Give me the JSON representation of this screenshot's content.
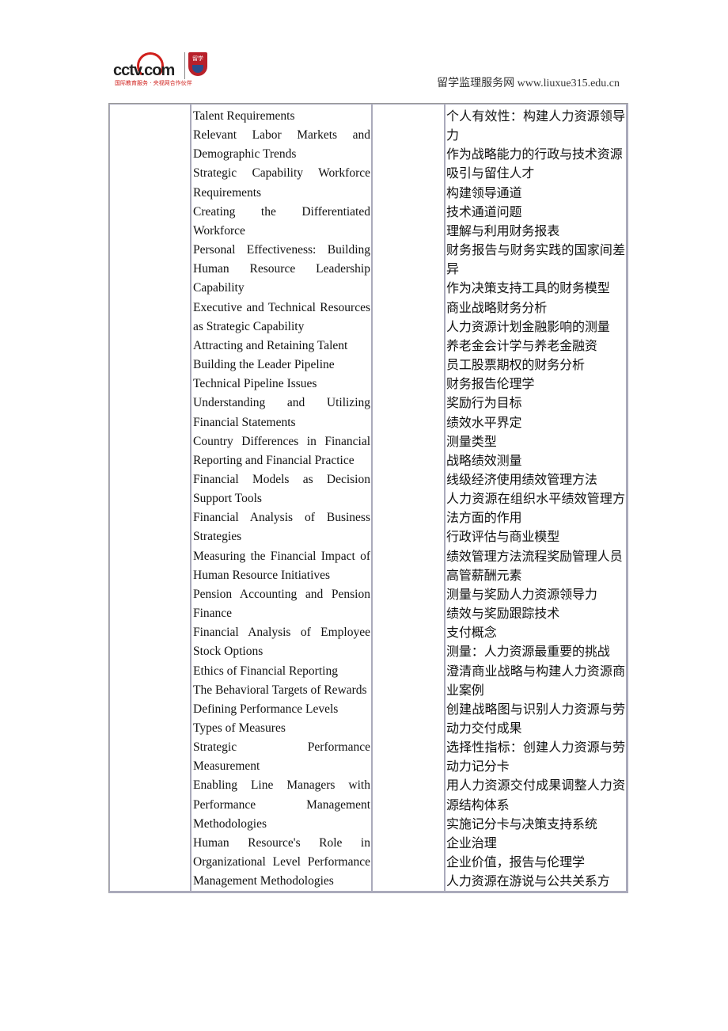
{
  "header": {
    "logo_text": "cctv.com",
    "logo_subtitle": "国际教育服务 · 央视网合作伙伴",
    "badge_text": "留学",
    "site_label": "留学监理服务网 www.liuxue315.edu.cn"
  },
  "table": {
    "english_items": [
      "Talent Requirements",
      "Relevant Labor Markets and Demographic Trends",
      "Strategic Capability Workforce Requirements",
      "Creating the Differentiated Workforce",
      "Personal Effectiveness: Building Human Resource Leadership Capability",
      "Executive and Technical Resources as Strategic Capability",
      "Attracting and Retaining Talent",
      "Building the Leader Pipeline",
      "Technical Pipeline Issues",
      "Understanding and Utilizing Financial Statements",
      "Country Differences in Financial Reporting and Financial Practice",
      "Financial Models as Decision Support Tools",
      "Financial Analysis of Business Strategies",
      "Measuring the Financial Impact of Human Resource Initiatives",
      "Pension Accounting and Pension Finance",
      "Financial Analysis of Employee Stock Options",
      "Ethics of Financial Reporting",
      "The Behavioral Targets of Rewards",
      "Defining Performance Levels",
      "Types of Measures",
      "Strategic Performance Measurement",
      "Enabling Line Managers with Performance Management Methodologies",
      "Human Resource's Role in Organizational Level Performance Management Methodologies"
    ],
    "chinese_items": [
      "个人有效性：构建人力资源领导力",
      "作为战略能力的行政与技术资源",
      "吸引与留住人才",
      "构建领导通道",
      "技术通道问题",
      "理解与利用财务报表",
      "财务报告与财务实践的国家间差异",
      "作为决策支持工具的财务模型",
      "商业战略财务分析",
      "人力资源计划金融影响的测量",
      "养老金会计学与养老金融资",
      "员工股票期权的财务分析",
      "财务报告伦理学",
      "奖励行为目标",
      "绩效水平界定",
      "测量类型",
      "战略绩效测量",
      "线级经济使用绩效管理方法",
      "人力资源在组织水平绩效管理方法方面的作用",
      "行政评估与商业模型",
      "绩效管理方法流程奖励管理人员",
      "高管薪酬元素",
      "测量与奖励人力资源领导力",
      "绩效与奖励跟踪技术",
      "支付概念",
      "测量：人力资源最重要的挑战",
      "澄清商业战略与构建人力资源商业案例",
      "创建战略图与识别人力资源与劳动力交付成果",
      "选择性指标：创建人力资源与劳动力记分卡",
      "用人力资源交付成果调整人力资源结构体系",
      "实施记分卡与决策支持系统",
      "企业治理",
      "企业价值，报告与伦理学",
      "人力资源在游说与公共关系方"
    ]
  }
}
